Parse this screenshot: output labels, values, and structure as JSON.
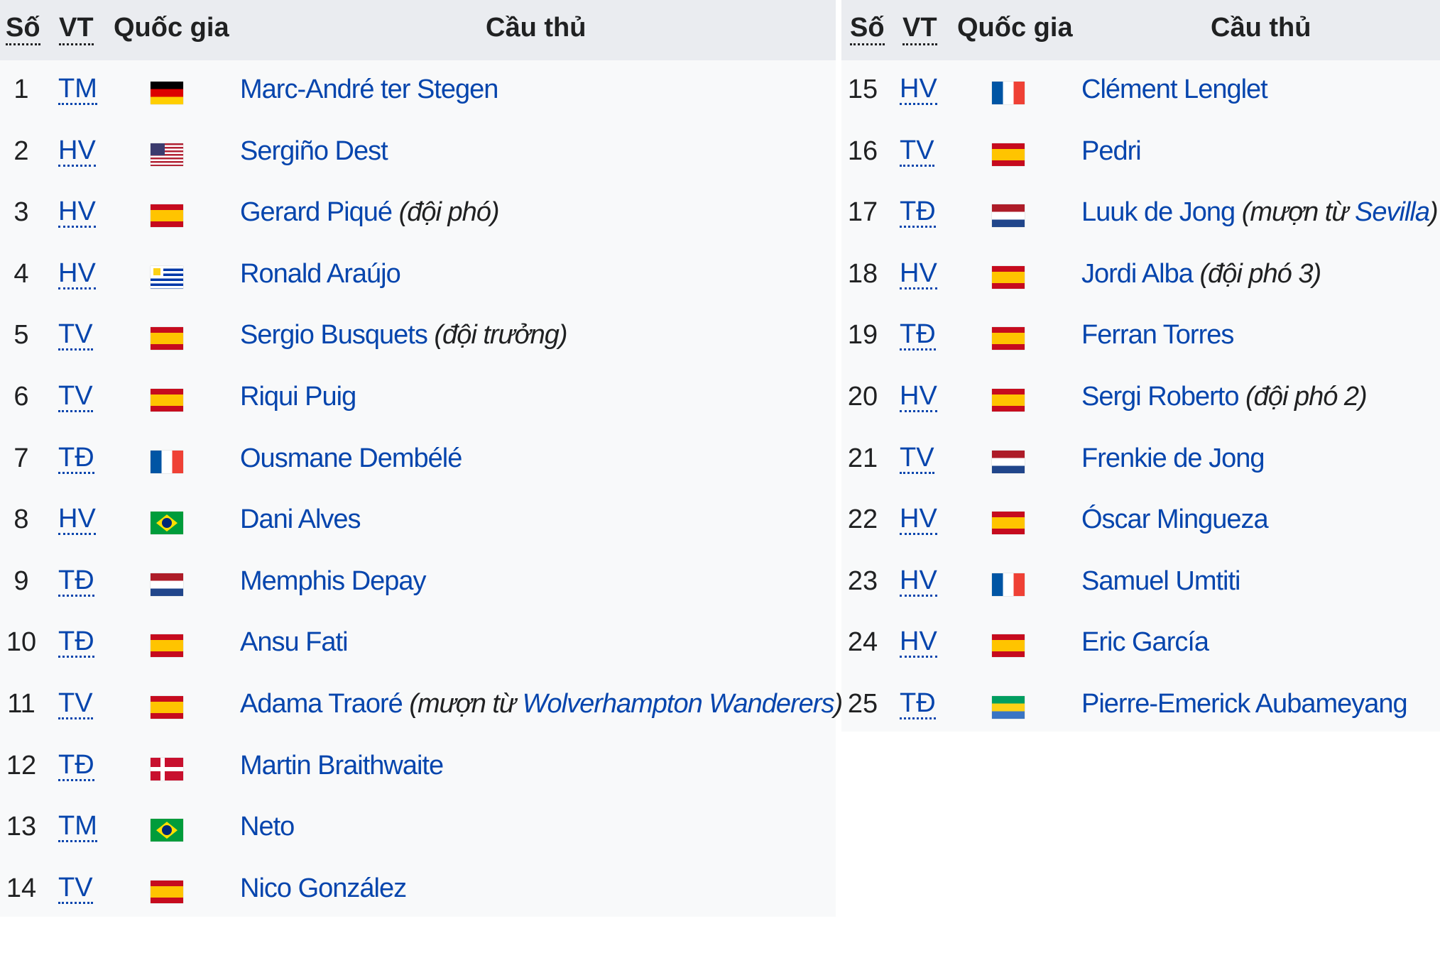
{
  "headers": {
    "number": "Số",
    "position": "VT",
    "country": "Quốc gia",
    "player": "Cầu thủ"
  },
  "left_players": [
    {
      "num": "1",
      "pos": "TM",
      "flag": "de",
      "name": "Marc-André ter Stegen"
    },
    {
      "num": "2",
      "pos": "HV",
      "flag": "us",
      "name": "Sergiño Dest"
    },
    {
      "num": "3",
      "pos": "HV",
      "flag": "es",
      "name": "Gerard Piqué",
      "note_pre": "(đội phó)"
    },
    {
      "num": "4",
      "pos": "HV",
      "flag": "uy",
      "name": "Ronald Araújo"
    },
    {
      "num": "5",
      "pos": "TV",
      "flag": "es",
      "name": "Sergio Busquets",
      "note_pre": "(đội trưởng)"
    },
    {
      "num": "6",
      "pos": "TV",
      "flag": "es",
      "name": "Riqui Puig"
    },
    {
      "num": "7",
      "pos": "TĐ",
      "flag": "fr",
      "name": "Ousmane Dembélé"
    },
    {
      "num": "8",
      "pos": "HV",
      "flag": "br",
      "name": "Dani Alves"
    },
    {
      "num": "9",
      "pos": "TĐ",
      "flag": "nl",
      "name": "Memphis Depay"
    },
    {
      "num": "10",
      "pos": "TĐ",
      "flag": "es",
      "name": "Ansu Fati"
    },
    {
      "num": "11",
      "pos": "TV",
      "flag": "es",
      "name": "Adama Traoré",
      "note_pre": "(mượn từ ",
      "note_link": "Wolverhampton Wanderers",
      "note_post": ")"
    },
    {
      "num": "12",
      "pos": "TĐ",
      "flag": "dk",
      "name": "Martin Braithwaite"
    },
    {
      "num": "13",
      "pos": "TM",
      "flag": "br",
      "name": "Neto"
    },
    {
      "num": "14",
      "pos": "TV",
      "flag": "es",
      "name": "Nico González"
    }
  ],
  "right_players": [
    {
      "num": "15",
      "pos": "HV",
      "flag": "fr",
      "name": "Clément Lenglet"
    },
    {
      "num": "16",
      "pos": "TV",
      "flag": "es",
      "name": "Pedri"
    },
    {
      "num": "17",
      "pos": "TĐ",
      "flag": "nl",
      "name": "Luuk de Jong",
      "note_pre": "(mượn từ ",
      "note_link": "Sevilla",
      "note_post": ")"
    },
    {
      "num": "18",
      "pos": "HV",
      "flag": "es",
      "name": "Jordi Alba",
      "note_pre": "(đội phó 3)"
    },
    {
      "num": "19",
      "pos": "TĐ",
      "flag": "es",
      "name": "Ferran Torres"
    },
    {
      "num": "20",
      "pos": "HV",
      "flag": "es",
      "name": "Sergi Roberto",
      "note_pre": "(đội phó 2)"
    },
    {
      "num": "21",
      "pos": "TV",
      "flag": "nl",
      "name": "Frenkie de Jong"
    },
    {
      "num": "22",
      "pos": "HV",
      "flag": "es",
      "name": "Óscar Mingueza"
    },
    {
      "num": "23",
      "pos": "HV",
      "flag": "fr",
      "name": "Samuel Umtiti"
    },
    {
      "num": "24",
      "pos": "HV",
      "flag": "es",
      "name": "Eric García"
    },
    {
      "num": "25",
      "pos": "TĐ",
      "flag": "ga",
      "name": "Pierre-Emerick Aubameyang"
    }
  ],
  "colors": {
    "link": "#0645ad",
    "header_bg": "#eaecf0",
    "table_bg": "#f8f9fa"
  }
}
